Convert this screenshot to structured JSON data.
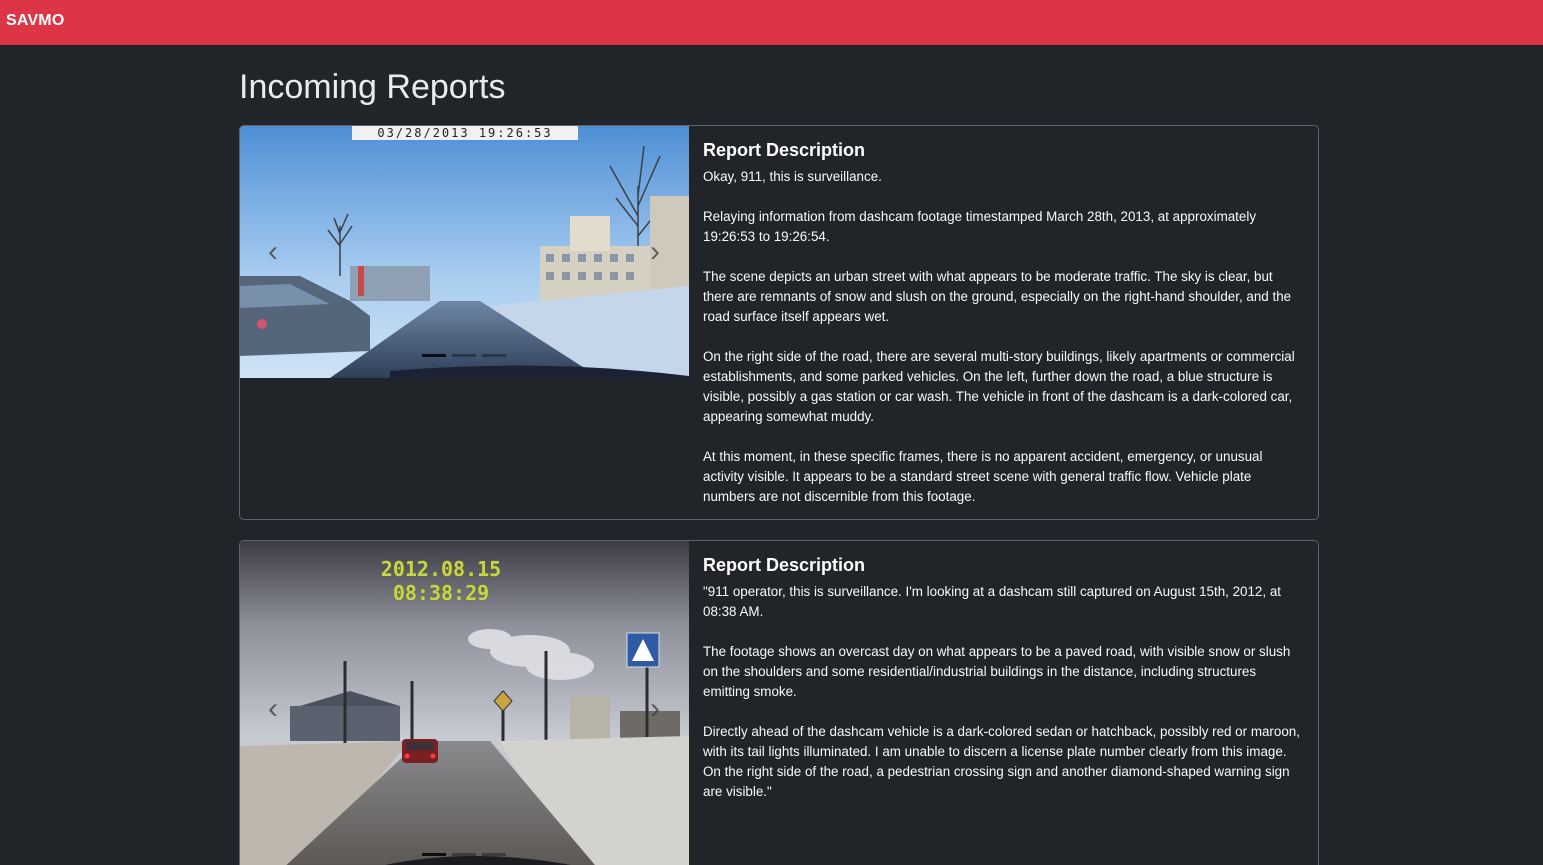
{
  "navbar": {
    "brand": "SAVMO"
  },
  "page": {
    "title": "Incoming Reports"
  },
  "reports": [
    {
      "timestamp_overlay": "03/28/2013 19:26:53",
      "description_title": "Report Description",
      "paragraphs": [
        "Okay, 911, this is surveillance.",
        "Relaying information from dashcam footage timestamped March 28th, 2013, at approximately 19:26:53 to 19:26:54.",
        "The scene depicts an urban street with what appears to be moderate traffic. The sky is clear, but there are remnants of snow and slush on the ground, especially on the right-hand shoulder, and the road surface itself appears wet.",
        "On the right side of the road, there are several multi-story buildings, likely apartments or commercial establishments, and some parked vehicles. On the left, further down the road, a blue structure is visible, possibly a gas station or car wash. The vehicle in front of the dashcam is a dark-colored car, appearing somewhat muddy.",
        "At this moment, in these specific frames, there is no apparent accident, emergency, or unusual activity visible. It appears to be a standard street scene with general traffic flow. Vehicle plate numbers are not discernible from this footage."
      ],
      "carousel": {
        "slides": 3,
        "active": 0,
        "prev_icon": "chevron-left",
        "next_icon": "chevron-right"
      }
    },
    {
      "timestamp_overlay": "2012.08.15 08:38:29",
      "description_title": "Report Description",
      "paragraphs": [
        "\"911 operator, this is surveillance. I'm looking at a dashcam still captured on August 15th, 2012, at 08:38 AM.",
        "The footage shows an overcast day on what appears to be a paved road, with visible snow or slush on the shoulders and some residential/industrial buildings in the distance, including structures emitting smoke.",
        "Directly ahead of the dashcam vehicle is a dark-colored sedan or hatchback, possibly red or maroon, with its tail lights illuminated. I am unable to discern a license plate number clearly from this image. On the right side of the road, a pedestrian crossing sign and another diamond-shaped warning sign are visible.\""
      ],
      "carousel": {
        "slides": 3,
        "active": 0,
        "prev_icon": "chevron-left",
        "next_icon": "chevron-right"
      }
    }
  ],
  "colors": {
    "navbar": "#dc3545",
    "background": "#212529",
    "card_border": "#5c636a"
  }
}
